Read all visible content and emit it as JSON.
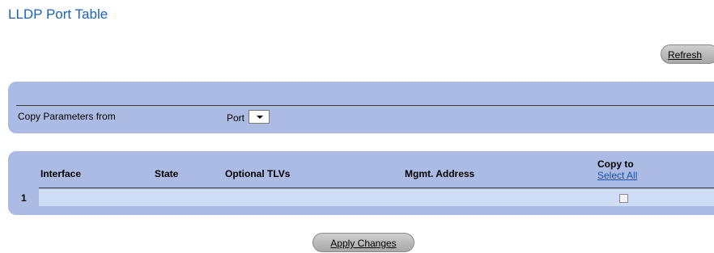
{
  "page": {
    "title": "LLDP Port Table"
  },
  "toolbar": {
    "refresh_label": "Refresh"
  },
  "copy_params": {
    "label": "Copy Parameters from",
    "select_value": "Port"
  },
  "table": {
    "columns": {
      "interface": "Interface",
      "state": "State",
      "optional_tlvs": "Optional TLVs",
      "mgmt_address": "Mgmt. Address",
      "copy_to": "Copy to"
    },
    "select_all_label": "Select All",
    "rows": [
      {
        "num": "1",
        "interface": "",
        "state": "",
        "optional_tlvs": "",
        "mgmt_address": "",
        "copy_checked": false
      }
    ]
  },
  "footer": {
    "apply_label": "Apply Changes"
  },
  "colors": {
    "title": "#1b63b8",
    "panel": "#abbbe3",
    "row": "#cfdcf6"
  },
  "icons": {
    "dropdown": "chevron-down-icon",
    "checkbox": "checkbox-icon"
  }
}
